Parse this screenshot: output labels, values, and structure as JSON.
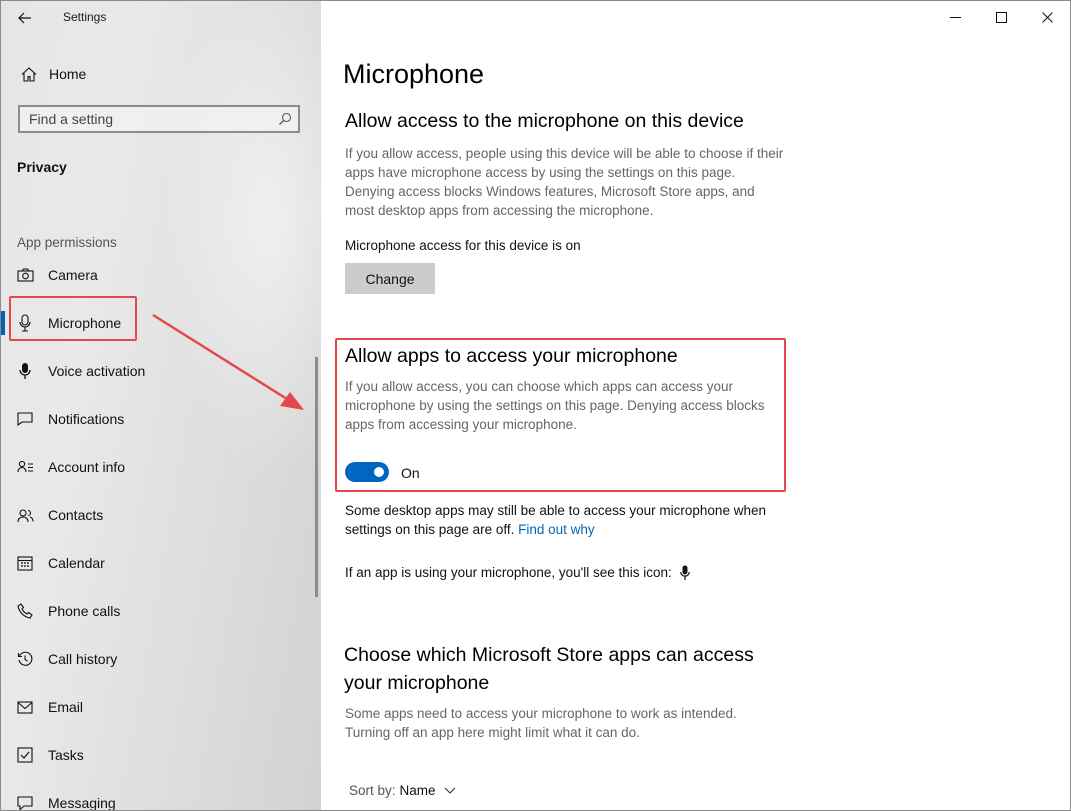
{
  "window": {
    "title": "Settings"
  },
  "sidebar": {
    "home_label": "Home",
    "search_placeholder": "Find a setting",
    "section_title": "Privacy",
    "group_label": "App permissions",
    "items": [
      {
        "label": "Camera",
        "icon": "camera-icon"
      },
      {
        "label": "Microphone",
        "icon": "microphone-icon",
        "selected": true
      },
      {
        "label": "Voice activation",
        "icon": "voice-microphone-icon"
      },
      {
        "label": "Notifications",
        "icon": "notifications-icon"
      },
      {
        "label": "Account info",
        "icon": "account-info-icon"
      },
      {
        "label": "Contacts",
        "icon": "contacts-icon"
      },
      {
        "label": "Calendar",
        "icon": "calendar-icon"
      },
      {
        "label": "Phone calls",
        "icon": "phone-icon"
      },
      {
        "label": "Call history",
        "icon": "history-icon"
      },
      {
        "label": "Email",
        "icon": "email-icon"
      },
      {
        "label": "Tasks",
        "icon": "tasks-icon"
      },
      {
        "label": "Messaging",
        "icon": "messaging-icon"
      }
    ]
  },
  "main": {
    "title": "Microphone",
    "device_section": {
      "heading": "Allow access to the microphone on this device",
      "description": "If you allow access, people using this device will be able to choose if their apps have microphone access by using the settings on this page. Denying access blocks Windows features, Microsoft Store apps, and most desktop apps from accessing the microphone.",
      "status": "Microphone access for this device is on",
      "change_label": "Change"
    },
    "apps_section": {
      "heading": "Allow apps to access your microphone",
      "description": "If you allow access, you can choose which apps can access your microphone by using the settings on this page. Denying access blocks apps from accessing your microphone.",
      "toggle_label": "On"
    },
    "desktop_note": "Some desktop apps may still be able to access your microphone when settings on this page are off.",
    "find_out_link": "Find out why",
    "icon_note": "If an app is using your microphone, you'll see this icon:",
    "store_section": {
      "heading_line1": "Choose which Microsoft Store apps can access",
      "heading_line2": "your microphone",
      "description": "Some apps need to access your microphone to work as intended. Turning off an app here might limit what it can do."
    },
    "sort": {
      "label": "Sort by:",
      "value": "Name"
    }
  },
  "colors": {
    "accent": "#0067c0",
    "annotation": "#e5474b",
    "link": "#0067b8"
  }
}
